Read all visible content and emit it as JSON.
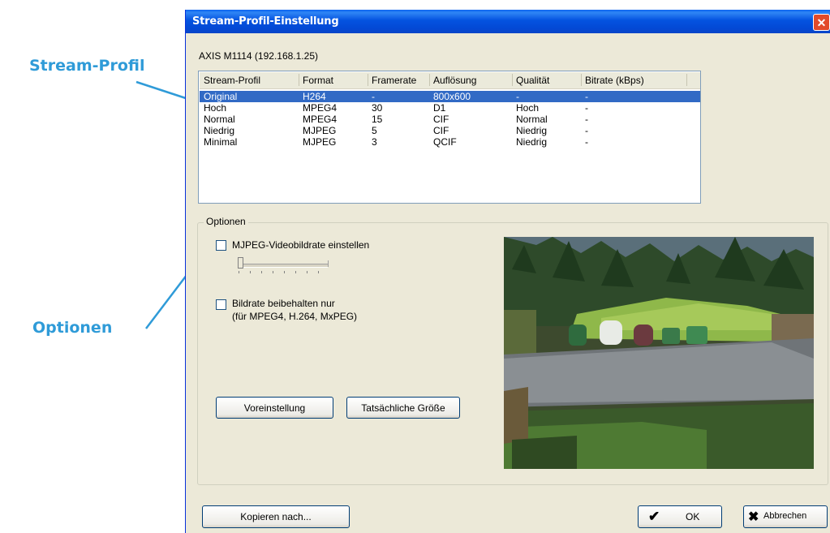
{
  "callouts": {
    "stream_profile": "Stream-Profil",
    "options": "Optionen"
  },
  "dialog": {
    "title": "Stream-Profil-Einstellung",
    "close_glyph": "✕",
    "device": "AXIS M1114 (192.168.1.25)"
  },
  "table": {
    "columns": [
      "Stream-Profil",
      "Format",
      "Framerate",
      "Auflösung",
      "Qualität",
      "Bitrate (kBps)"
    ],
    "rows": [
      [
        "Original",
        "H264",
        "-",
        "800x600",
        "-",
        "-"
      ],
      [
        "Hoch",
        "MPEG4",
        "30",
        "D1",
        "Hoch",
        "-"
      ],
      [
        "Normal",
        "MPEG4",
        "15",
        "CIF",
        "Normal",
        "-"
      ],
      [
        "Niedrig",
        "MJPEG",
        "5",
        "CIF",
        "Niedrig",
        "-"
      ],
      [
        "Minimal",
        "MJPEG",
        "3",
        "QCIF",
        "Niedrig",
        "-"
      ]
    ],
    "selected_row": "Original"
  },
  "options": {
    "legend": "Optionen",
    "mjpeg_checkbox": "MJPEG-Videobildrate einstellen",
    "mjpeg_checked": false,
    "keep_rate_checkbox_line1": "Bildrate beibehalten nur",
    "keep_rate_checkbox_line2": "(für MPEG4, H.264, MxPEG)",
    "keep_rate_checked": false,
    "slider_value": 0,
    "default_button": "Voreinstellung",
    "actual_size_button": "Tatsächliche Größe"
  },
  "footer": {
    "copy_button": "Kopieren nach...",
    "ok_button": "OK",
    "cancel_button": "Abbrechen"
  },
  "colors": {
    "titlebar": "#0453e0",
    "selection": "#316ac5",
    "callout": "#2f9bd8",
    "dialog_bg": "#ece9d8"
  }
}
